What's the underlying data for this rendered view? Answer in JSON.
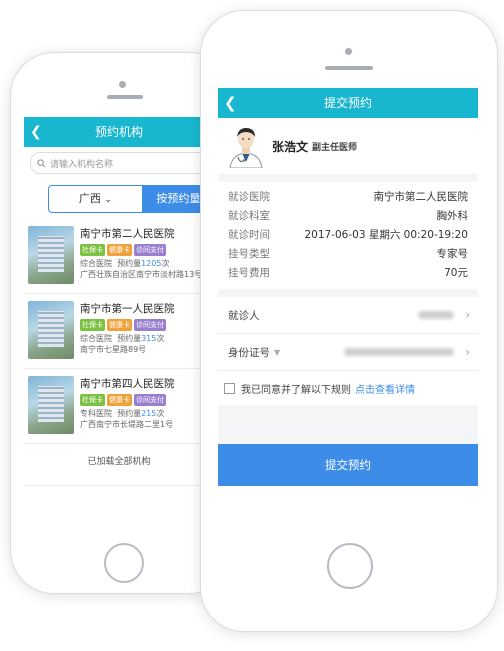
{
  "back_screen": {
    "title": "预约机构",
    "back_icon": "chevron-left-icon",
    "search_placeholder": "请输入机构名称",
    "region_label": "广西",
    "sort_label": "按预约量",
    "hospitals": [
      {
        "name": "南宁市第二人民医院",
        "tags": [
          "社保卡",
          "健康卡",
          "诊间支付"
        ],
        "type": "综合医院",
        "volume_label": "预约量",
        "volume": "1205",
        "volume_unit": "次",
        "address": "广西壮族自治区南宁市淡村路13号"
      },
      {
        "name": "南宁市第一人民医院",
        "tags": [
          "社保卡",
          "健康卡",
          "诊间支付"
        ],
        "type": "综合医院",
        "volume_label": "预约量",
        "volume": "315",
        "volume_unit": "次",
        "address": "南宁市七星路89号"
      },
      {
        "name": "南宁市第四人民医院",
        "tags": [
          "社保卡",
          "健康卡",
          "诊间支付"
        ],
        "type": "专科医院",
        "volume_label": "预约量",
        "volume": "215",
        "volume_unit": "次",
        "address": "广西南宁市长堤路二里1号"
      }
    ],
    "loaded_text": "已加载全部机构"
  },
  "front_screen": {
    "title": "提交预约",
    "back_icon": "chevron-left-icon",
    "doctor": {
      "name": "张浩文",
      "title": "副主任医师"
    },
    "details": [
      {
        "label": "就诊医院",
        "value": "南宁市第二人民医院"
      },
      {
        "label": "就诊科室",
        "value": "胸外科"
      },
      {
        "label": "就诊时间",
        "value": "2017-06-03 星期六 00:20-19:20"
      },
      {
        "label": "挂号类型",
        "value": "专家号"
      },
      {
        "label": "挂号费用",
        "value": "70元"
      }
    ],
    "patient_label": "就诊人",
    "id_label": "身份证号",
    "agree_text": "我已同意并了解以下规则",
    "agree_link": "点击查看详情",
    "submit_label": "提交预约"
  },
  "colors": {
    "header": "#19b7cf",
    "primary_blue": "#3d8ce8",
    "tag_green": "#7cc142",
    "tag_orange": "#f0a23a",
    "tag_purple": "#9a7fd1"
  }
}
